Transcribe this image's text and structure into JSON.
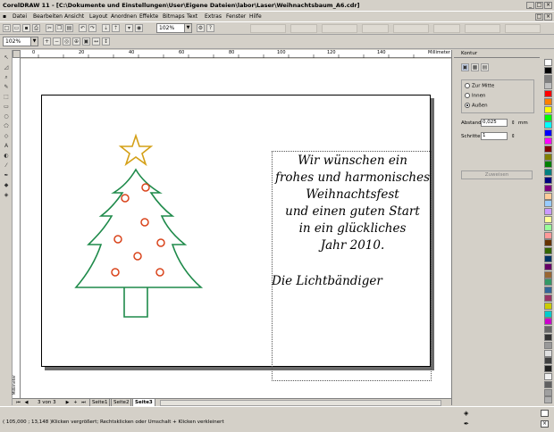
{
  "window": {
    "title": "CorelDRAW 11 - [C:\\Dokumente und Einstellungen\\User\\Eigene Dateien\\labor\\Laser\\Weihnachtsbaum_A6.cdr]"
  },
  "menu": {
    "items": [
      "Datei",
      "Bearbeiten",
      "Ansicht",
      "Layout",
      "Anordnen",
      "Effekte",
      "Bitmaps",
      "Text",
      "Extras",
      "Fenster",
      "Hilfe"
    ]
  },
  "toolbar": {
    "zoom_value": "102%"
  },
  "propertybar": {
    "zoom_value": "102%"
  },
  "ruler": {
    "unit": "Millimeter",
    "ticks": [
      "0",
      "20",
      "40",
      "60",
      "80",
      "100",
      "120",
      "140"
    ]
  },
  "vruler": {
    "unit": "Millimeter"
  },
  "document": {
    "greeting_lines": [
      "Wir wünschen ein",
      "frohes und harmonisches",
      "Weihnachtsfest",
      "und einen guten Start",
      "in ein glückliches",
      "Jahr 2010."
    ],
    "signature": "Die Lichtbändiger"
  },
  "navigation": {
    "page_counter": "3 von 3",
    "tabs": [
      "Seite1",
      "Seite2",
      "Seite3"
    ],
    "active_tab": "Seite3"
  },
  "docker": {
    "title": "Kontur",
    "options": [
      "Zur Mitte",
      "Innen",
      "Außen"
    ],
    "selected_option": "Außen",
    "abstand_label": "Abstand:",
    "abstand_value": "0,025",
    "abstand_unit": "mm",
    "schritte_label": "Schritte:",
    "schritte_value": "1",
    "apply_label": "Zuweisen"
  },
  "status": {
    "coordinates": "( 105,000 ; 13,148 )",
    "hint": "Klicken vergrößert; Rechtsklicken oder Umschalt + Klicken verkleinert"
  },
  "colors": {
    "tree": "#1e8a4a",
    "star": "#d4a017",
    "ornament": "#d9441c",
    "trunk": "#1e8a4a"
  },
  "palette": [
    "#ffffff",
    "#000000",
    "#808080",
    "#c0c0c0",
    "#ff0000",
    "#ff8000",
    "#ffff00",
    "#00ff00",
    "#00ffff",
    "#0000ff",
    "#ff00ff",
    "#800000",
    "#808000",
    "#008000",
    "#008080",
    "#000080",
    "#800080",
    "#ffcc99",
    "#99ccff",
    "#cc99ff",
    "#ffff99",
    "#99ff99",
    "#ff9999",
    "#663300",
    "#336600",
    "#003366",
    "#660066",
    "#996633",
    "#339966",
    "#336699",
    "#993366",
    "#cccc00",
    "#00cccc",
    "#cc00cc",
    "#666666",
    "#333333",
    "#999999",
    "#e0e0e0",
    "#404040",
    "#202020",
    "#f0f0f0",
    "#606060",
    "#a0a0a0",
    "#b0b0b0"
  ]
}
